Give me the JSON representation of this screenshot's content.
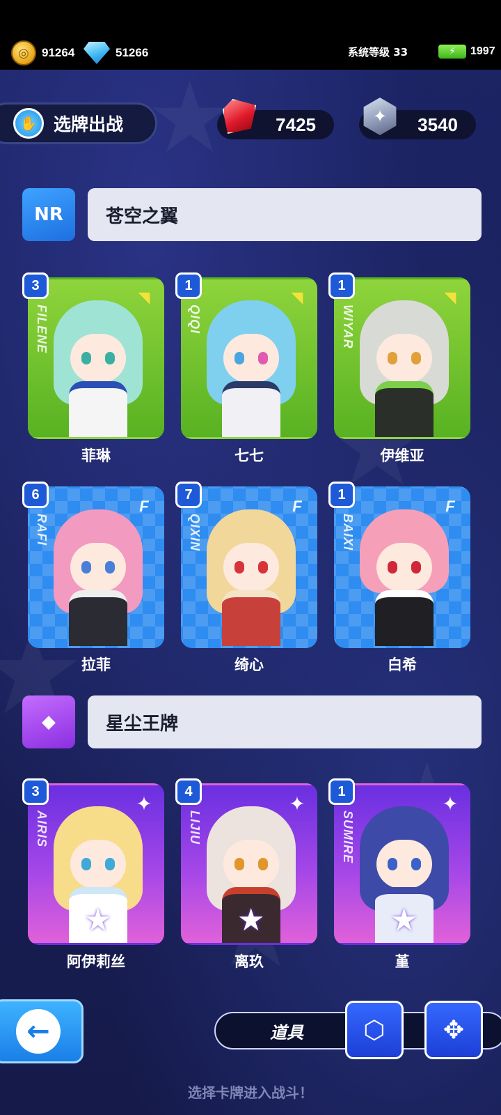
{
  "status": {
    "gold": "91264",
    "diamonds": "51266",
    "system_level": "系统等级 33",
    "energy": "1997"
  },
  "header": {
    "title": "选牌出战",
    "ruby": "7425",
    "medal": "3540"
  },
  "sections": [
    {
      "name": "苍空之翼",
      "icon": "card-deck-icon",
      "cards": [
        {
          "level": "3",
          "code": "FILENE",
          "name": "菲琳",
          "style": "green"
        },
        {
          "level": "1",
          "code": "QIQI",
          "name": "七七",
          "style": "green"
        },
        {
          "level": "1",
          "code": "WIYAR",
          "name": "伊维亚",
          "style": "green"
        },
        {
          "level": "6",
          "code": "RAFI",
          "name": "拉菲",
          "style": "blue"
        },
        {
          "level": "7",
          "code": "QIXIN",
          "name": "绮心",
          "style": "blue"
        },
        {
          "level": "1",
          "code": "BAIXI",
          "name": "白希",
          "style": "blue"
        }
      ]
    },
    {
      "name": "星尘王牌",
      "icon": "diamond-icon",
      "cards": [
        {
          "level": "3",
          "code": "AIRIS",
          "name": "阿伊莉丝",
          "style": "purple"
        },
        {
          "level": "4",
          "code": "LIJIU",
          "name": "离玖",
          "style": "purple"
        },
        {
          "level": "1",
          "code": "SUMIRE",
          "name": "堇",
          "style": "purple"
        }
      ]
    }
  ],
  "footer": {
    "tool_label": "道具",
    "hint": "选择卡牌进入战斗！"
  },
  "colors": {
    "background": "#1b2160",
    "accent_blue": "#1e5ad8",
    "section_bar": "#e4e6f1"
  }
}
